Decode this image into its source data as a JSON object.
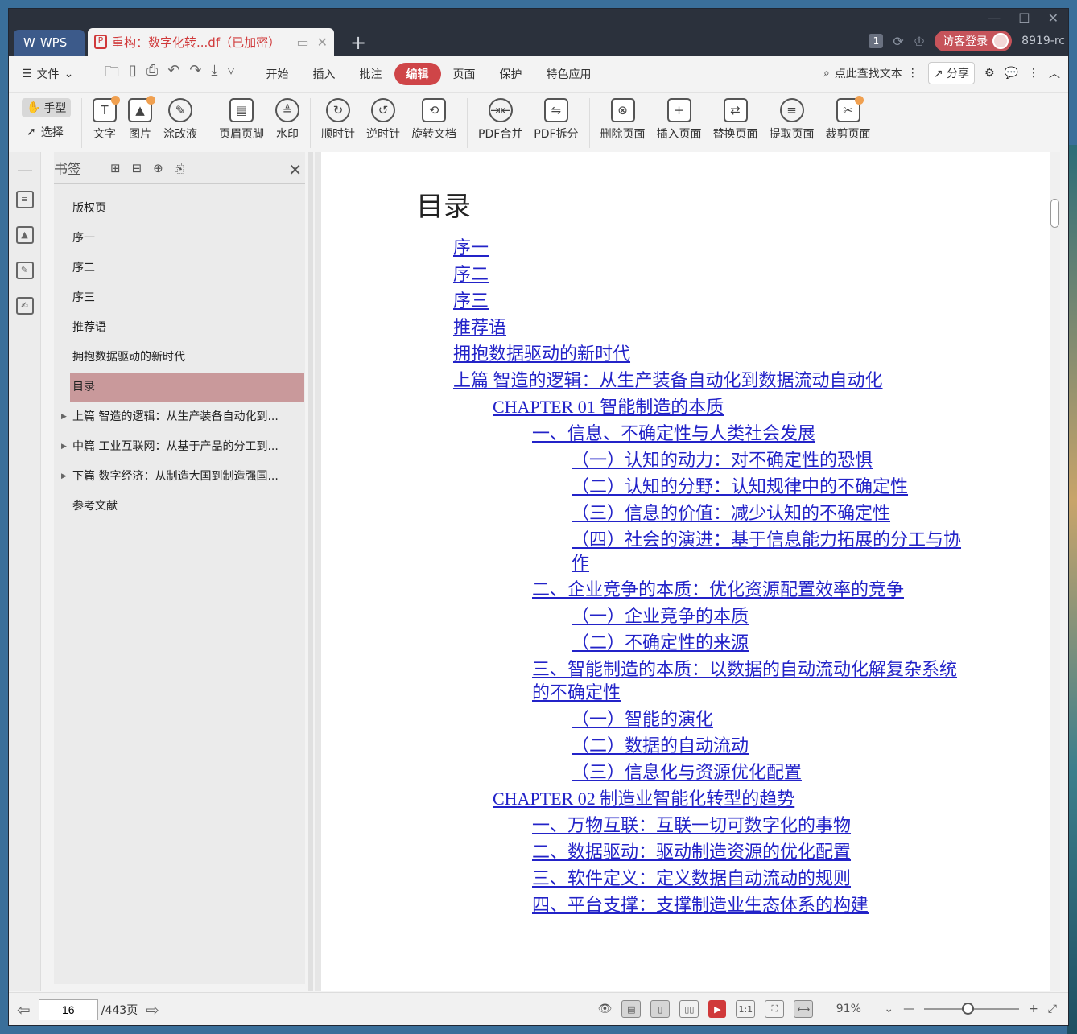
{
  "window": {
    "app_tab": "WPS",
    "doc_tab": "重构：数字化转...df（已加密）",
    "new_tab_icon": "plus-icon",
    "page_count_badge": "1",
    "login_button": "访客登录",
    "user_id": "8919-rc"
  },
  "menubar": {
    "file_label": "文件",
    "tabs": [
      "开始",
      "插入",
      "批注",
      "编辑",
      "页面",
      "保护",
      "特色应用"
    ],
    "active_tab": "编辑",
    "search_label": "点此查找文本",
    "share_label": "分享"
  },
  "ribbon": {
    "hand_label": "手型",
    "select_label": "选择",
    "tools": [
      "文字",
      "图片",
      "涂改液",
      "页眉页脚",
      "水印",
      "顺时针",
      "逆时针",
      "旋转文档",
      "PDF合并",
      "PDF拆分",
      "删除页面",
      "插入页面",
      "替换页面",
      "提取页面",
      "裁剪页面"
    ]
  },
  "bookmarks": {
    "title": "书签",
    "items": [
      "版权页",
      "序一",
      "序二",
      "序三",
      "推荐语",
      "拥抱数据驱动的新时代",
      "目录",
      "上篇 智造的逻辑：从生产装备自动化到...",
      "中篇 工业互联网：从基于产品的分工到...",
      "下篇 数字经济：从制造大国到制造强国...",
      "参考文献"
    ],
    "active_index": 6
  },
  "document": {
    "heading": "目录",
    "toc": [
      {
        "level": 1,
        "text": "序一"
      },
      {
        "level": 1,
        "text": "序二"
      },
      {
        "level": 1,
        "text": "序三"
      },
      {
        "level": 1,
        "text": "推荐语"
      },
      {
        "level": 1,
        "text": "拥抱数据驱动的新时代"
      },
      {
        "level": 1,
        "text": "上篇 智造的逻辑：从生产装备自动化到数据流动自动化"
      },
      {
        "level": 2,
        "text": "CHAPTER 01 智能制造的本质"
      },
      {
        "level": 3,
        "text": "一、信息、不确定性与人类社会发展"
      },
      {
        "level": 4,
        "text": "（一）认知的动力：对不确定性的恐惧"
      },
      {
        "level": 4,
        "text": "（二）认知的分野：认知规律中的不确定性"
      },
      {
        "level": 4,
        "text": "（三）信息的价值：减少认知的不确定性"
      },
      {
        "level": 4,
        "text": "（四）社会的演进：基于信息能力拓展的分工与协作"
      },
      {
        "level": 3,
        "text": "二、企业竞争的本质：优化资源配置效率的竞争"
      },
      {
        "level": 4,
        "text": "（一）企业竞争的本质"
      },
      {
        "level": 4,
        "text": "（二）不确定性的来源"
      },
      {
        "level": 3,
        "text": "三、智能制造的本质：以数据的自动流动化解复杂系统的不确定性"
      },
      {
        "level": 4,
        "text": "（一）智能的演化"
      },
      {
        "level": 4,
        "text": "（二）数据的自动流动"
      },
      {
        "level": 4,
        "text": "（三）信息化与资源优化配置"
      },
      {
        "level": 2,
        "text": "CHAPTER 02 制造业智能化转型的趋势"
      },
      {
        "level": 3,
        "text": "一、万物互联：互联一切可数字化的事物"
      },
      {
        "level": 3,
        "text": "二、数据驱动：驱动制造资源的优化配置"
      },
      {
        "level": 3,
        "text": "三、软件定义：定义数据自动流动的规则"
      },
      {
        "level": 3,
        "text": "四、平台支撑：支撑制造业生态体系的构建"
      }
    ]
  },
  "statusbar": {
    "current_page": "16",
    "total_pages": "/443页",
    "zoom": "91%",
    "zoom_fraction": 0.45
  },
  "colors": {
    "accent": "#cf4548",
    "link": "#2323c8",
    "active_bookmark": "#c9999b",
    "titlebar": "#2b313c"
  }
}
